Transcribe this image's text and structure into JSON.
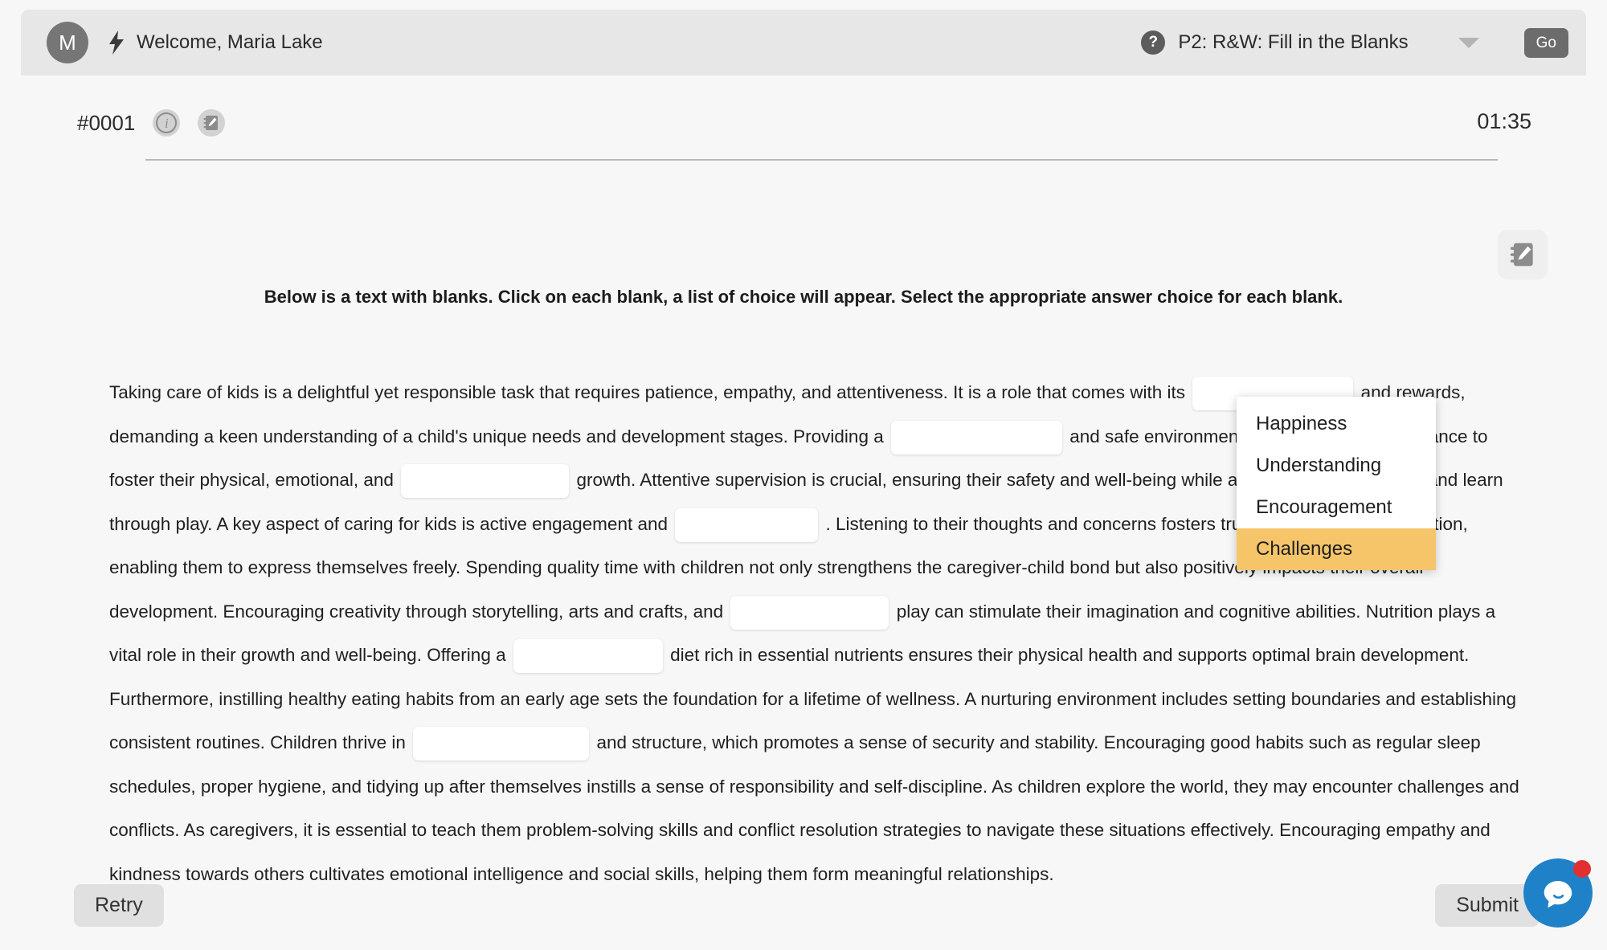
{
  "header": {
    "avatar_initial": "M",
    "bolt_icon": "lightning-bolt-icon",
    "welcome_text": "Welcome, Maria Lake",
    "help_icon": "?",
    "task_label": "P2: R&W: Fill in the Blanks",
    "task_options": [
      "P2: R&W: Fill in the Blanks"
    ],
    "go_label": "Go"
  },
  "question": {
    "number": "#0001",
    "info_icon": "i",
    "notes_icon": "notepad-pencil-icon",
    "timer": "01:35"
  },
  "instructions": "Below is a text with blanks. Click on each blank, a list of choice will appear. Select the appropriate answer choice for each blank.",
  "passage": {
    "seg1": "Taking care of kids is a delightful yet responsible task that requires patience, empathy, and attentiveness. It is a role that comes with its",
    "seg2": "and rewards, demanding a keen understanding of a child's unique needs and development stages. Providing a",
    "seg3": "and safe environment is of paramount importance to foster their physical, emotional, and",
    "seg4": "growth. Attentive supervision is crucial, ensuring their safety and well-being while allowing them to explore and learn through play. A key aspect of caring for kids is active engagement and",
    "seg5": ". Listening to their thoughts and concerns fosters trust and open communication, enabling them to express themselves freely. Spending quality time with children not only strengthens the caregiver-child bond but also positively impacts their overall development. Encouraging creativity through storytelling, arts and crafts, and",
    "seg6": "play can stimulate their imagination and cognitive abilities. Nutrition plays a vital role in their growth and well-being. Offering a",
    "seg7": "diet rich in essential nutrients ensures their physical health and supports optimal brain development. Furthermore, instilling healthy eating habits from an early age sets the foundation for a lifetime of wellness. A nurturing environment includes setting boundaries and establishing consistent routines. Children thrive in",
    "seg8": "and structure, which promotes a sense of security and stability. Encouraging good habits such as regular sleep schedules, proper hygiene, and tidying up after themselves instills a sense of responsibility and self-discipline. As children explore the world, they may encounter challenges and conflicts. As caregivers, it is essential to teach them problem-solving skills and conflict resolution strategies to navigate these situations effectively. Encouraging empathy and kindness towards others cultivates emotional intelligence and social skills, helping them form meaningful relationships."
  },
  "choice_menu": {
    "options": [
      "Happiness",
      "Understanding",
      "Encouragement",
      "Challenges"
    ],
    "selected": "Challenges",
    "highlight_color": "#f6c569"
  },
  "footer": {
    "retry_label": "Retry",
    "submit_label": "Submit"
  },
  "chat": {
    "icon": "chat-bubble-icon",
    "accent_color": "#1f82c8",
    "badge_color": "#e03030"
  }
}
